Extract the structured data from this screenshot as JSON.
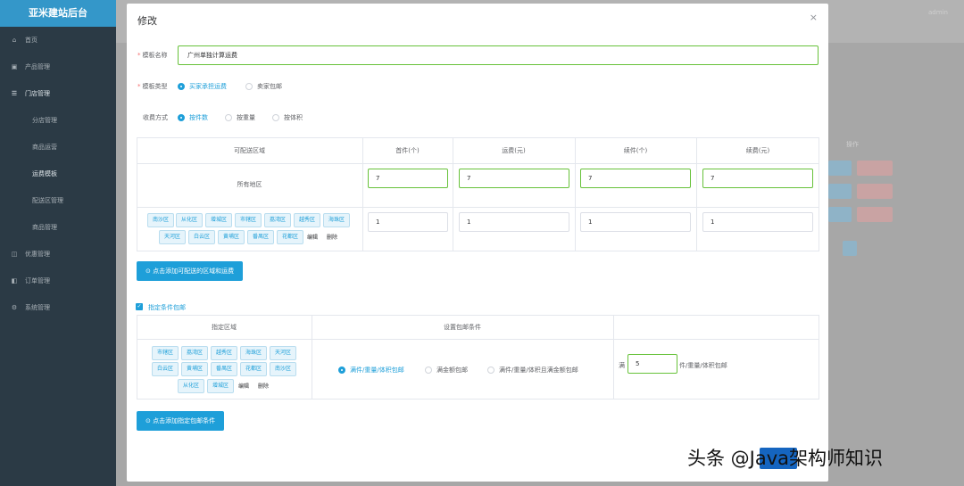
{
  "sidebar": {
    "brand": "亚米建站后台",
    "items": [
      {
        "icon": "⌂",
        "label": "首页"
      },
      {
        "icon": "▣",
        "label": "产品管理"
      },
      {
        "icon": "☰",
        "label": "门店管理"
      },
      {
        "label": "分店管理"
      },
      {
        "label": "商品运营"
      },
      {
        "label": "运费模板"
      },
      {
        "label": "配送区管理"
      },
      {
        "label": "商品管理"
      },
      {
        "icon": "◫",
        "label": "优惠管理"
      },
      {
        "icon": "◧",
        "label": "订单管理"
      },
      {
        "icon": "⚙",
        "label": "系统管理"
      }
    ]
  },
  "background": {
    "admin": "admin",
    "col_action": "操作"
  },
  "modal": {
    "title": "修改",
    "close": "×",
    "template_name_label": "模板名称",
    "template_name_value": "广州单独计算运费",
    "template_type_label": "模板类型",
    "template_type_options": [
      "买家承担运费",
      "卖家包邮"
    ],
    "charge_method_label": "收费方式",
    "charge_method_options": [
      "按件数",
      "按重量",
      "按体积"
    ],
    "fee_table": {
      "headers": [
        "可配送区域",
        "首件(个)",
        "运费(元)",
        "续件(个)",
        "续费(元)"
      ],
      "row1": {
        "region": "所有地区",
        "values": [
          "7",
          "7",
          "7",
          "7"
        ]
      },
      "row2": {
        "tags": [
          "南沙区",
          "从化区",
          "增城区",
          "市辖区",
          "荔湾区",
          "越秀区",
          "海珠区",
          "天河区",
          "白云区",
          "黄埔区",
          "番禺区",
          "花都区"
        ],
        "edit": "编辑",
        "delete": "删除",
        "values": [
          "1",
          "1",
          "1",
          "1"
        ]
      }
    },
    "add_region_button": "点击添加可配送的区域和运费",
    "free_shipping_checkbox": "指定条件包邮",
    "free_table": {
      "headers": [
        "指定区域",
        "设置包邮条件",
        ""
      ],
      "tags": [
        "市辖区",
        "荔湾区",
        "越秀区",
        "海珠区",
        "天河区",
        "白云区",
        "黄埔区",
        "番禺区",
        "花都区",
        "南沙区",
        "从化区",
        "增城区"
      ],
      "edit": "编辑",
      "delete": "删除",
      "conditions": [
        "满件/重量/体积包邮",
        "满金额包邮",
        "满件/重量/体积且满金额包邮"
      ],
      "full_prefix": "满",
      "full_value": "5",
      "full_suffix": "件/重量/体积包邮"
    },
    "add_condition_button": "点击添加指定包邮条件"
  },
  "watermark": "头条 @Java架构师知识"
}
